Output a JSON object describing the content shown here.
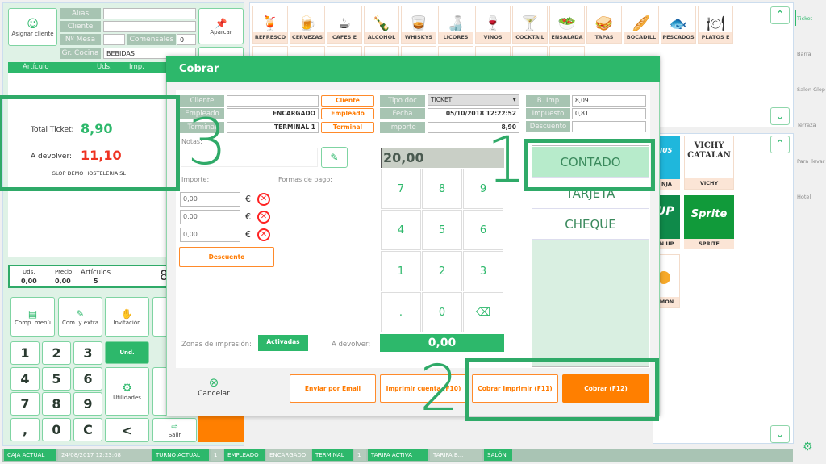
{
  "left": {
    "assign_client": "Asignar cliente",
    "labels": {
      "alias": "Alias",
      "cliente": "Cliente",
      "mesa": "Nº Mesa",
      "comensales": "Comensales",
      "gr_cocina": "Gr. Cocina"
    },
    "values": {
      "alias": "",
      "cliente": "",
      "mesa": "",
      "comensales": "0",
      "gr_cocina": "BEBIDAS"
    },
    "park": "Aparcar",
    "columns": [
      "Artículo",
      "Uds.",
      "Imp."
    ],
    "total_label": "Total Ticket:",
    "total_value": "8,90",
    "return_label": "A devolver:",
    "return_value": "11,10",
    "company": "GLOP DEMO HOSTELERIA SL",
    "summary": {
      "uds_label": "Uds.",
      "uds": "0,00",
      "precio_label": "Precio",
      "precio": "0,00",
      "articulos_label": "Artículos",
      "articulos": "5",
      "big": "8"
    },
    "actions": [
      "Comp. menú",
      "Com. y extra",
      "Invitación",
      "An"
    ],
    "keypad": [
      "1",
      "2",
      "3",
      "4",
      "5",
      "6",
      "7",
      "8",
      "9",
      ",",
      "0",
      "C"
    ],
    "und": "Und.",
    "utilidades": "Utilidades",
    "ab": "Ab",
    "back": "<",
    "salir": "Salir"
  },
  "categories": [
    "REFRESCO",
    "CERVEZAS",
    "CAFES E",
    "ALCOHOL",
    "WHISKYS",
    "LICORES",
    "VINOS",
    "COCKTAIL",
    "ENSALADA",
    "TAPAS",
    "BOCADILL",
    "PESCADOS",
    "PLATOS E"
  ],
  "products": [
    {
      "label": "NJA",
      "logo": "RIUS"
    },
    {
      "label": "VICHY",
      "logo": "VICHY CATALAN"
    },
    {
      "label": "N UP",
      "logo": "UP"
    },
    {
      "label": "SPRITE",
      "logo": "Sprite"
    },
    {
      "label": "MON",
      "logo": ""
    }
  ],
  "sidebar": [
    "Ticket",
    "Barra",
    "Salon Glop",
    "Terraza",
    "Para llevar",
    "Hotel"
  ],
  "dialog": {
    "title": "Cobrar",
    "cliente_label": "Cliente",
    "cliente": "",
    "cliente_btn": "Cliente",
    "empleado_label": "Empleado",
    "empleado": "ENCARGADO",
    "empleado_btn": "Empleado",
    "terminal_label": "Terminal",
    "terminal": "TERMINAL 1",
    "terminal_btn": "Terminal",
    "tipo_doc_label": "Tipo doc",
    "tipo_doc": "TICKET",
    "fecha_label": "Fecha",
    "fecha": "05/10/2018 12:22:52",
    "importe_label": "Importe",
    "importe": "8,90",
    "bimp_label": "B. Imp",
    "bimp": "8,09",
    "impuesto_label": "Impuesto",
    "impuesto": "0,81",
    "descuento_label": "Descuento",
    "descuento": "",
    "notas_label": "Notas:",
    "importe_col": "Importe:",
    "formas_label": "Formas de pago:",
    "amounts": [
      "0,00",
      "0,00",
      "0,00"
    ],
    "currency": "€",
    "descuento_btn": "Descuento",
    "display": "20,00",
    "keys": [
      "7",
      "8",
      "9",
      "4",
      "5",
      "6",
      "1",
      "2",
      "3",
      ".",
      "0"
    ],
    "zonas_label": "Zonas de impresión:",
    "zonas_btn": "Activadas",
    "devolver_label": "A devolver:",
    "devolver": "0,00",
    "payment_methods": [
      "CONTADO",
      "TARJETA",
      "CHEQUE"
    ],
    "cancel": "Cancelar",
    "email": "Enviar por Email",
    "print_account": "Imprimir cuenta (F10)",
    "charge_print": "Cobrar Imprimir (F11)",
    "charge": "Cobrar (F12)"
  },
  "annotations": [
    "1",
    "2",
    "3"
  ],
  "status": [
    {
      "t": "CAJA ACTUAL",
      "g": true
    },
    {
      "t": "24/08/2017   12:23:08",
      "g": false
    },
    {
      "t": "TURNO ACTUAL",
      "g": true
    },
    {
      "t": "1",
      "g": false
    },
    {
      "t": "EMPLEADO",
      "g": true
    },
    {
      "t": "ENCARGADO",
      "g": false
    },
    {
      "t": "TERMINAL",
      "g": true
    },
    {
      "t": "1",
      "g": false
    },
    {
      "t": "TARIFA ACTIVA",
      "g": true
    },
    {
      "t": "TARIFA B...",
      "g": false
    },
    {
      "t": "SALÓN",
      "g": true
    }
  ],
  "colors": {
    "green": "#2db86b",
    "orange": "#ff7f00",
    "gray_label": "#a7c4b2"
  }
}
